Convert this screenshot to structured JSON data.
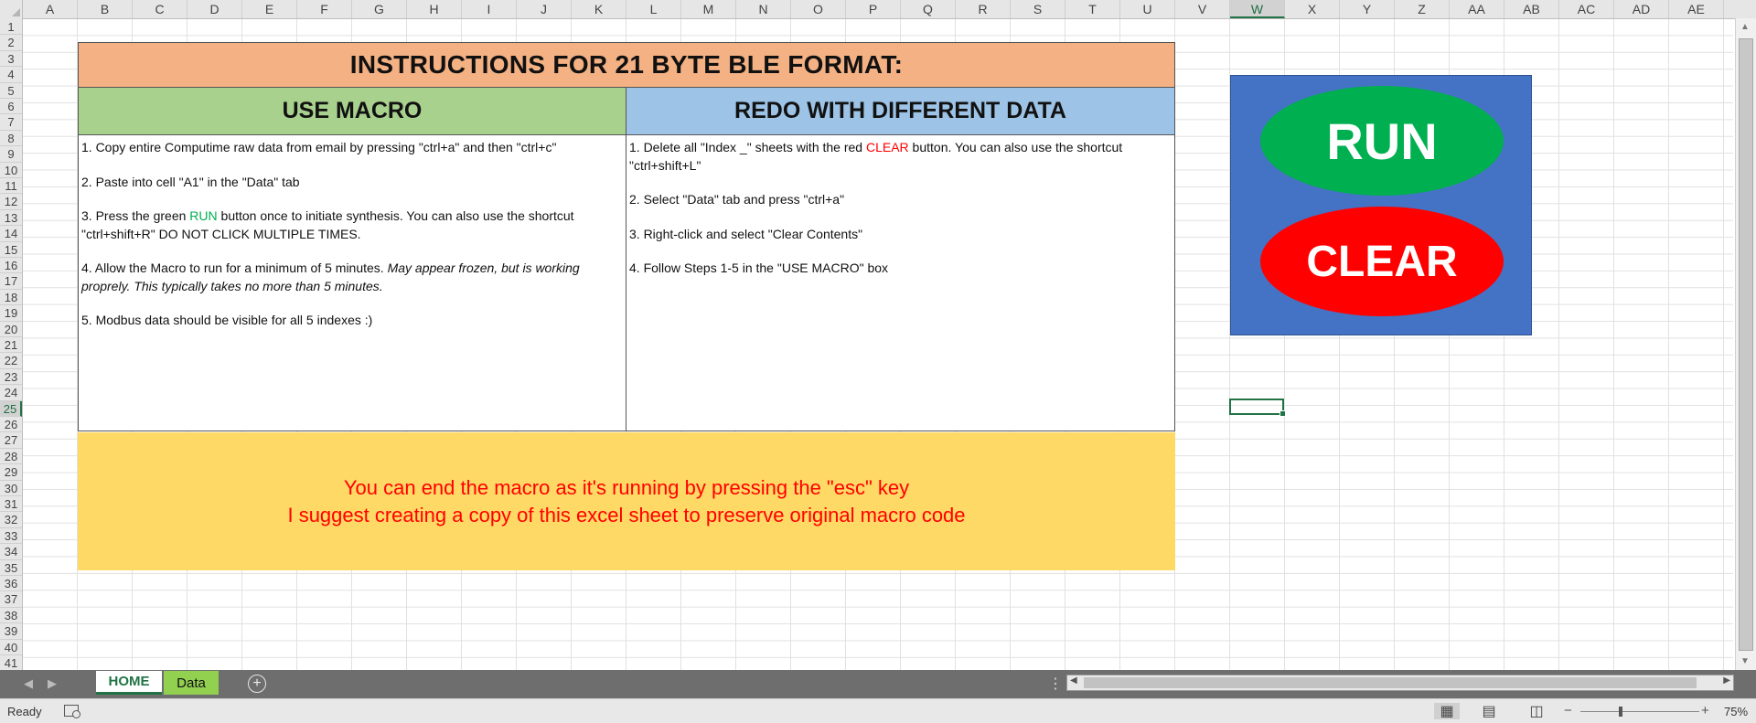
{
  "columns": [
    "A",
    "B",
    "C",
    "D",
    "E",
    "F",
    "G",
    "H",
    "I",
    "J",
    "K",
    "L",
    "M",
    "N",
    "O",
    "P",
    "Q",
    "R",
    "S",
    "T",
    "U",
    "V",
    "W",
    "X",
    "Y",
    "Z",
    "AA",
    "AB",
    "AC",
    "AD",
    "AE"
  ],
  "rows": [
    "1",
    "2",
    "3",
    "4",
    "5",
    "6",
    "7",
    "8",
    "9",
    "10",
    "11",
    "12",
    "13",
    "14",
    "15",
    "16",
    "17",
    "18",
    "19",
    "20",
    "21",
    "22",
    "23",
    "24",
    "25",
    "26",
    "27",
    "28",
    "29",
    "30",
    "31",
    "32",
    "33",
    "34",
    "35",
    "36",
    "37",
    "38",
    "39",
    "40",
    "41"
  ],
  "selected_column": "W",
  "selected_row": "25",
  "instructions": {
    "title": "INSTRUCTIONS FOR 21 BYTE BLE FORMAT:",
    "use_macro": {
      "header": "USE MACRO",
      "step1": "1. Copy entire Computime raw data from email by pressing \"ctrl+a\" and then \"ctrl+c\"",
      "step2": "2. Paste into cell \"A1\" in the \"Data\" tab",
      "step3_pre": "3. Press the green ",
      "step3_run": "RUN",
      "step3_post": " button once to initiate synthesis. You can also use the shortcut \"ctrl+shift+R\"  DO NOT CLICK MULTIPLE TIMES.",
      "step4_pre": "4. Allow the Macro to run for a minimum of 5 minutes. ",
      "step4_italic": "May appear frozen, but is working proprely. This typically takes no more than 5 minutes.",
      "step5": "5. Modbus data should be visible for all 5 indexes :)"
    },
    "redo": {
      "header": "REDO WITH DIFFERENT DATA",
      "step1_pre": "1. Delete all \"Index _\" sheets with the red ",
      "step1_clear": "CLEAR",
      "step1_post": " button. You can also use the shortcut \"ctrl+shift+L\"",
      "step2": "2. Select \"Data\" tab and press \"ctrl+a\"",
      "step3": "3. Right-click and select \"Clear Contents\"",
      "step4": "4. Follow Steps 1-5 in the \"USE MACRO\" box"
    },
    "note_line1": "You can end the macro as it's running by pressing the \"esc\" key",
    "note_line2": "I suggest creating a copy of this excel sheet to preserve original macro code"
  },
  "buttons": {
    "run_label": "RUN",
    "clear_label": "CLEAR"
  },
  "sheet_tabs": {
    "home": "HOME",
    "data": "Data",
    "add_icon": "plus-circle-icon"
  },
  "status_bar": {
    "ready": "Ready",
    "zoom_level": "75%",
    "zoom_minus": "−",
    "zoom_plus": "+"
  },
  "colors": {
    "title_bg": "#f4b183",
    "macro_header_bg": "#a9d18e",
    "redo_header_bg": "#9dc3e6",
    "note_bg": "#ffd966",
    "note_text": "#ff0000",
    "button_panel_bg": "#4472c4",
    "run_button": "#00b050",
    "clear_button": "#ff0000",
    "accent_green": "#217346",
    "data_tab_bg": "#92d050"
  }
}
